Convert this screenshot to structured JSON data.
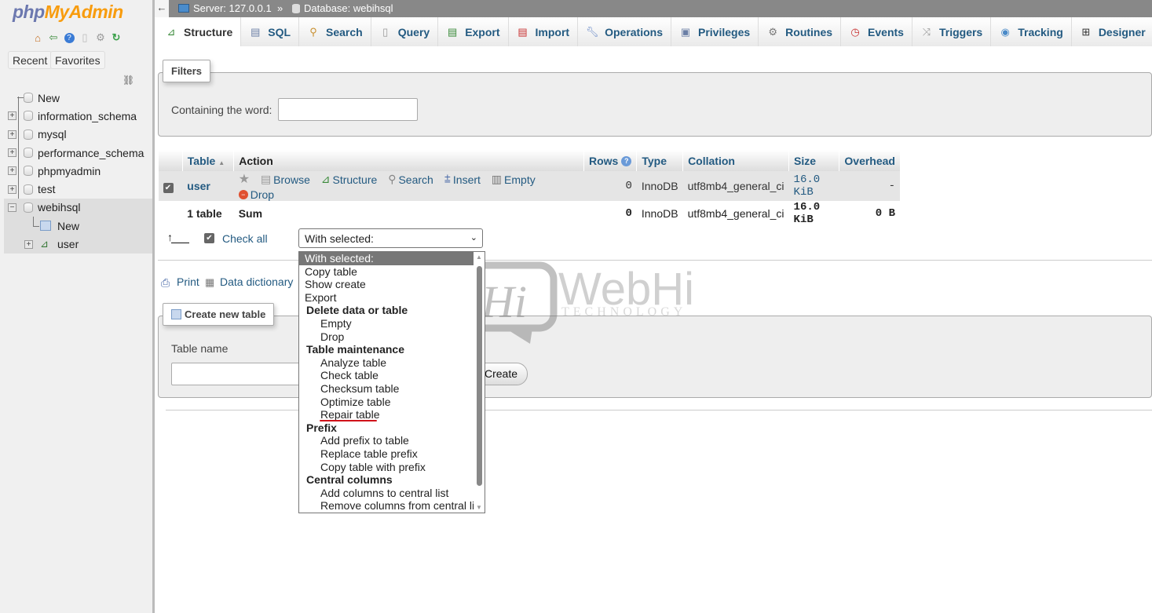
{
  "sidebar": {
    "logo_php": "php",
    "logo_myadmin": "MyAdmin",
    "quick_icons": [
      "home-icon",
      "logout-icon",
      "help-icon",
      "docs-icon",
      "settings-icon",
      "reload-icon"
    ],
    "recent_label": "Recent",
    "favorites_label": "Favorites",
    "tree": [
      {
        "label": "New",
        "type": "new"
      },
      {
        "label": "information_schema",
        "type": "db"
      },
      {
        "label": "mysql",
        "type": "db"
      },
      {
        "label": "performance_schema",
        "type": "db"
      },
      {
        "label": "phpmyadmin",
        "type": "db"
      },
      {
        "label": "test",
        "type": "db"
      },
      {
        "label": "webihsql",
        "type": "db",
        "expanded": true
      },
      {
        "label": "New",
        "type": "new-table"
      },
      {
        "label": "user",
        "type": "table"
      }
    ]
  },
  "breadcrumb": {
    "server": "Server: 127.0.0.1",
    "separator": "»",
    "database": "Database: webihsql"
  },
  "tabs": [
    {
      "label": "Structure",
      "icon": "structure-icon",
      "active": true
    },
    {
      "label": "SQL",
      "icon": "sql-icon"
    },
    {
      "label": "Search",
      "icon": "search-icon"
    },
    {
      "label": "Query",
      "icon": "query-icon"
    },
    {
      "label": "Export",
      "icon": "export-icon"
    },
    {
      "label": "Import",
      "icon": "import-icon"
    },
    {
      "label": "Operations",
      "icon": "operations-icon"
    },
    {
      "label": "Privileges",
      "icon": "privileges-icon"
    },
    {
      "label": "Routines",
      "icon": "routines-icon"
    },
    {
      "label": "Events",
      "icon": "events-icon"
    },
    {
      "label": "Triggers",
      "icon": "triggers-icon"
    },
    {
      "label": "Tracking",
      "icon": "tracking-icon"
    },
    {
      "label": "Designer",
      "icon": "designer-icon"
    }
  ],
  "filters": {
    "legend": "Filters",
    "label": "Containing the word:",
    "value": ""
  },
  "table": {
    "headers": [
      "Table",
      "Action",
      "Rows",
      "Type",
      "Collation",
      "Size",
      "Overhead"
    ],
    "sort_indicator": "▲",
    "rows": [
      {
        "name": "user",
        "checked": true,
        "actions": [
          "Browse",
          "Structure",
          "Search",
          "Insert",
          "Empty",
          "Drop"
        ],
        "rows": "0",
        "type": "InnoDB",
        "collation": "utf8mb4_general_ci",
        "size": "16.0 KiB",
        "overhead": "-"
      }
    ],
    "summary": {
      "name": "1 table",
      "action": "Sum",
      "rows": "0",
      "type": "InnoDB",
      "collation": "utf8mb4_general_ci",
      "size": "16.0 KiB",
      "overhead": "0 B"
    }
  },
  "bulk": {
    "check_all": "Check all",
    "with_selected": "With selected:",
    "options": [
      {
        "label": "With selected:",
        "kind": "hdr"
      },
      {
        "label": "Copy table",
        "kind": "opt"
      },
      {
        "label": "Show create",
        "kind": "opt"
      },
      {
        "label": "Export",
        "kind": "opt"
      },
      {
        "label": "Delete data or table",
        "kind": "grp"
      },
      {
        "label": "Empty",
        "kind": "sub"
      },
      {
        "label": "Drop",
        "kind": "sub"
      },
      {
        "label": "Table maintenance",
        "kind": "grp"
      },
      {
        "label": "Analyze table",
        "kind": "sub"
      },
      {
        "label": "Check table",
        "kind": "sub"
      },
      {
        "label": "Checksum table",
        "kind": "sub"
      },
      {
        "label": "Optimize table",
        "kind": "sub"
      },
      {
        "label": "Repair table",
        "kind": "sub"
      },
      {
        "label": "Prefix",
        "kind": "grp"
      },
      {
        "label": "Add prefix to table",
        "kind": "sub"
      },
      {
        "label": "Replace table prefix",
        "kind": "sub"
      },
      {
        "label": "Copy table with prefix",
        "kind": "sub"
      },
      {
        "label": "Central columns",
        "kind": "grp"
      },
      {
        "label": "Add columns to central list",
        "kind": "sub"
      },
      {
        "label": "Remove columns from central list",
        "kind": "sub"
      }
    ]
  },
  "links": {
    "print": "Print",
    "data_dictionary": "Data dictionary"
  },
  "create_table": {
    "legend": "Create new table",
    "name_label": "Table name",
    "name_value": "",
    "create_button": "Create"
  },
  "watermark": {
    "mark": "Hi",
    "brand": "WebHi",
    "sub": "TECHNOLOGY"
  },
  "colors": {
    "link": "#235a81",
    "accent_orange": "#f89c0e",
    "accent_purple": "#6c78af",
    "highlight_underline": "#d0121a"
  }
}
